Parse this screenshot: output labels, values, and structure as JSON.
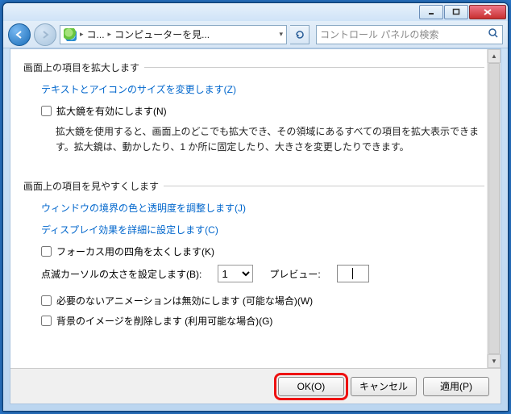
{
  "titlebar": {},
  "navbar": {
    "addr_seg1": "コ...",
    "addr_seg2": "コンピューターを見...",
    "search_placeholder": "コントロール パネルの検索"
  },
  "section1": {
    "legend": "画面上の項目を拡大します",
    "link_text_size": "テキストとアイコンのサイズを変更します(Z)",
    "chk_magnifier": "拡大鏡を有効にします(N)",
    "magnifier_desc": "拡大鏡を使用すると、画面上のどこでも拡大でき、その領域にあるすべての項目を拡大表示できます。拡大鏡は、動かしたり、1 か所に固定したり、大きさを変更したりできます。"
  },
  "section2": {
    "legend": "画面上の項目を見やすくします",
    "link_border": "ウィンドウの境界の色と透明度を調整します(J)",
    "link_display": "ディスプレイ効果を詳細に設定します(C)",
    "chk_focus": "フォーカス用の四角を太くします(K)",
    "cursor_label": "点滅カーソルの太さを設定します(B):",
    "cursor_value": "1",
    "preview_label": "プレビュー:",
    "chk_anim": "必要のないアニメーションは無効にします (可能な場合)(W)",
    "chk_bg": "背景のイメージを削除します (利用可能な場合)(G)"
  },
  "footer": {
    "ok": "OK(O)",
    "cancel": "キャンセル",
    "apply": "適用(P)"
  }
}
